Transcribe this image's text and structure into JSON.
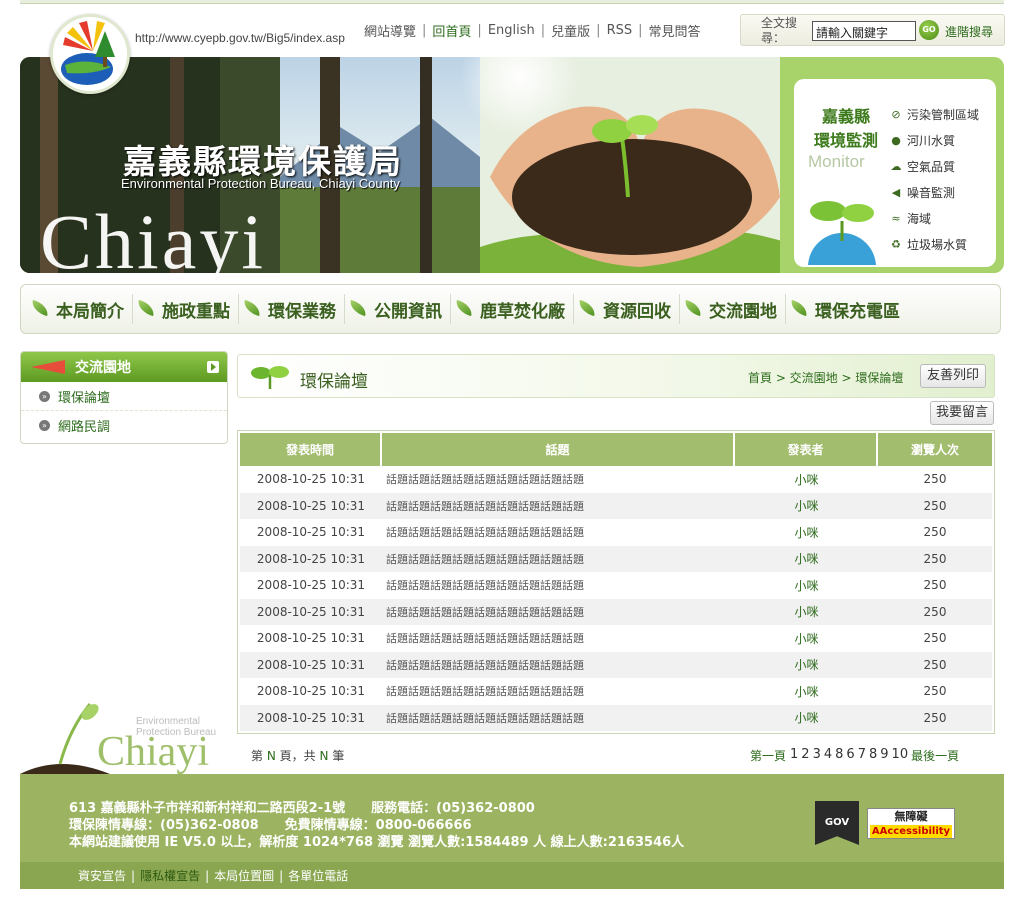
{
  "site": {
    "url": "http://www.cyepb.gov.tw/Big5/index.asp"
  },
  "topnav": {
    "items": [
      "網站導覽",
      "回首頁",
      "English",
      "兒童版",
      "RSS",
      "常見問答"
    ]
  },
  "search": {
    "label": "全文搜尋：",
    "value": "請輸入關鍵字",
    "go_label": "GO",
    "advanced_label": "進階搜尋"
  },
  "banner": {
    "title": "嘉義縣環境保護局",
    "subtitle": "Environmental Protection Bureau, Chiayi County",
    "chiayi": "Chiayi",
    "monitor_title_1": "嘉義縣",
    "monitor_title_2": "環境監測",
    "monitor_en": "Monitor",
    "monitor_items": [
      {
        "icon": "ban-icon",
        "label": "污染管制區域"
      },
      {
        "icon": "water-drop-icon",
        "label": "河川水質"
      },
      {
        "icon": "cloud-icon",
        "label": "空氣品質"
      },
      {
        "icon": "speaker-icon",
        "label": "噪音監測"
      },
      {
        "icon": "wave-icon",
        "label": "海域"
      },
      {
        "icon": "recycle-icon",
        "label": "垃圾場水質"
      }
    ]
  },
  "mainnav": {
    "items": [
      "本局簡介",
      "施政重點",
      "環保業務",
      "公開資訊",
      "鹿草焚化廠",
      "資源回收",
      "交流園地",
      "環保充電區"
    ]
  },
  "sidebar": {
    "title": "交流園地",
    "items": [
      "環保論壇",
      "網路民調"
    ]
  },
  "sidelogo": {
    "en_line1": "Environmental",
    "en_line2": "Protection Bureau",
    "name": "Chiayi"
  },
  "content": {
    "title": "環保論壇",
    "breadcrumb": "首頁 > 交流園地 > 環保論壇",
    "print_label": "友善列印",
    "post_label": "我要留言"
  },
  "table": {
    "headers": [
      "發表時間",
      "話題",
      "發表者",
      "瀏覽人次"
    ],
    "rows": [
      [
        "2008-10-25 10:31",
        "話題話題話題話題話題話題話題話題話題",
        "小咪",
        "250"
      ],
      [
        "2008-10-25 10:31",
        "話題話題話題話題話題話題話題話題話題",
        "小咪",
        "250"
      ],
      [
        "2008-10-25 10:31",
        "話題話題話題話題話題話題話題話題話題",
        "小咪",
        "250"
      ],
      [
        "2008-10-25 10:31",
        "話題話題話題話題話題話題話題話題話題",
        "小咪",
        "250"
      ],
      [
        "2008-10-25 10:31",
        "話題話題話題話題話題話題話題話題話題",
        "小咪",
        "250"
      ],
      [
        "2008-10-25 10:31",
        "話題話題話題話題話題話題話題話題話題",
        "小咪",
        "250"
      ],
      [
        "2008-10-25 10:31",
        "話題話題話題話題話題話題話題話題話題",
        "小咪",
        "250"
      ],
      [
        "2008-10-25 10:31",
        "話題話題話題話題話題話題話題話題話題",
        "小咪",
        "250"
      ],
      [
        "2008-10-25 10:31",
        "話題話題話題話題話題話題話題話題話題",
        "小咪",
        "250"
      ],
      [
        "2008-10-25 10:31",
        "話題話題話題話題話題話題話題話題話題",
        "小咪",
        "250"
      ]
    ]
  },
  "pager": {
    "summary_prefix": "第",
    "page_n": "N",
    "summary_mid": "頁，共",
    "total_n": "N",
    "summary_suffix": "筆",
    "first_label": "第一頁",
    "pages": [
      "1",
      "2",
      "3",
      "4",
      "8",
      "6",
      "7",
      "8",
      "9",
      "10"
    ],
    "last_label": "最後一頁"
  },
  "footer": {
    "line1": "613 嘉義縣朴子市祥和新村祥和二路西段2-1號　　服務電話：(05)362-0800",
    "line2": "環保陳情專線：(05)362-0808　　免費陳情專線：0800-066666",
    "line3": "本網站建議使用 IE V5.0 以上，解析度 1024*768 瀏覽 瀏覽人數:1584489 人 線上人數:2163546人",
    "gov_label": "GOV",
    "acc_label_1": "無障礙",
    "acc_label_2": "AAccessibility",
    "links": [
      "資安宣告",
      "隱私權宣告",
      "本局位置圖",
      "各單位電話"
    ]
  }
}
